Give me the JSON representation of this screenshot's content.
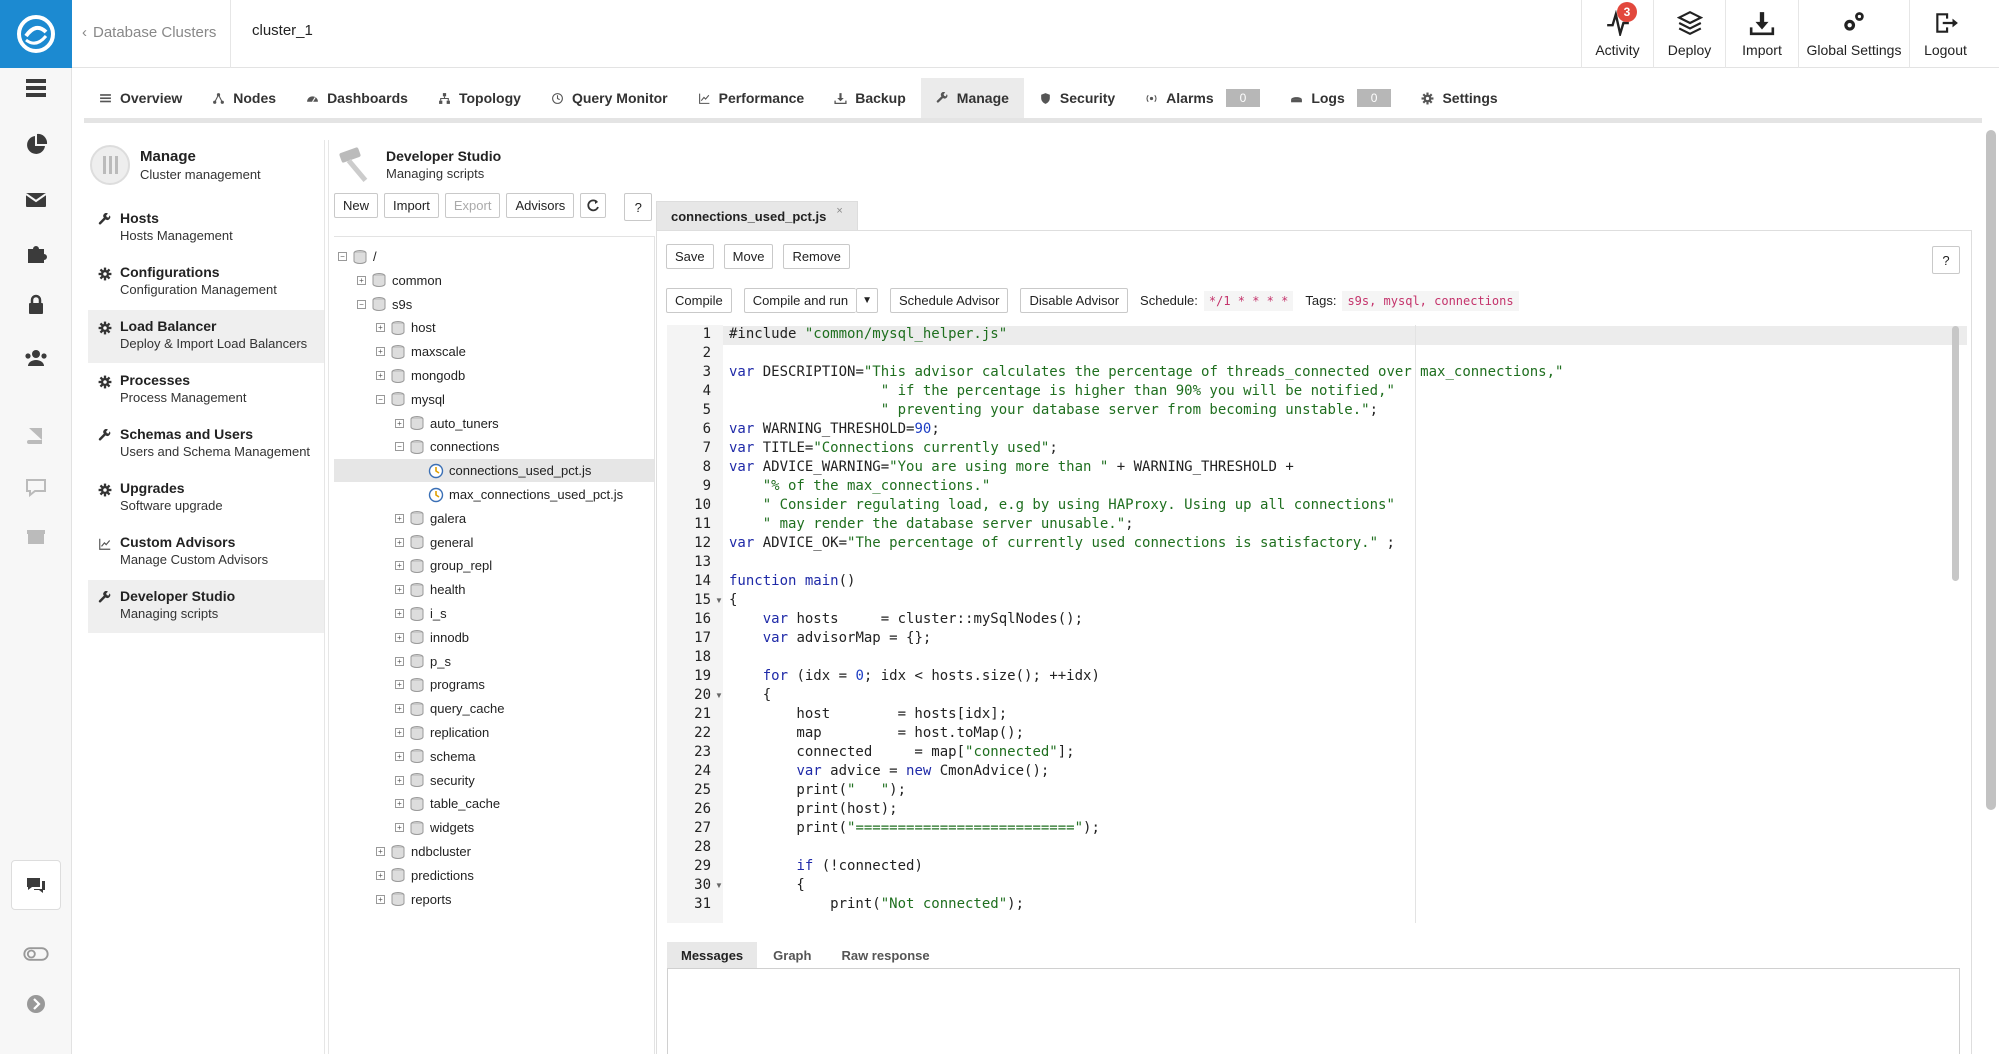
{
  "rail": {
    "icons": [
      "clusters-icon",
      "dashboard-pie-icon",
      "mail-icon",
      "puzzle-icon",
      "lock-icon",
      "users-icon",
      "book-icon",
      "chat-bubble-icon",
      "gift-icon",
      "chat-icon",
      "toggle-icon",
      "chevron-right-circle-icon"
    ]
  },
  "topbar": {
    "back_label": "Database Clusters",
    "cluster": "cluster_1",
    "actions": [
      {
        "label": "Activity",
        "icon": "activity-icon",
        "badge": "3"
      },
      {
        "label": "Deploy",
        "icon": "deploy-layers-icon"
      },
      {
        "label": "Import",
        "icon": "import-icon"
      },
      {
        "label": "Global Settings",
        "icon": "gears-icon"
      },
      {
        "label": "Logout",
        "icon": "logout-icon"
      }
    ]
  },
  "navtabs": [
    {
      "label": "Overview",
      "icon": "list-icon"
    },
    {
      "label": "Nodes",
      "icon": "nodes-icon"
    },
    {
      "label": "Dashboards",
      "icon": "gauge-icon"
    },
    {
      "label": "Topology",
      "icon": "topology-icon"
    },
    {
      "label": "Query Monitor",
      "icon": "query-icon"
    },
    {
      "label": "Performance",
      "icon": "chart-icon"
    },
    {
      "label": "Backup",
      "icon": "download-icon"
    },
    {
      "label": "Manage",
      "icon": "wrench-icon",
      "active": true
    },
    {
      "label": "Security",
      "icon": "shield-icon"
    },
    {
      "label": "Alarms",
      "icon": "alarm-icon",
      "count": "0"
    },
    {
      "label": "Logs",
      "icon": "logs-icon",
      "count": "0"
    },
    {
      "label": "Settings",
      "icon": "gear-icon"
    }
  ],
  "manage": {
    "title": "Manage",
    "subtitle": "Cluster management",
    "items": [
      {
        "title": "Hosts",
        "subtitle": "Hosts Management",
        "icon": "wrench-icon"
      },
      {
        "title": "Configurations",
        "subtitle": "Configuration Management",
        "icon": "gear-icon"
      },
      {
        "title": "Load Balancer",
        "subtitle": "Deploy & Import Load Balancers",
        "icon": "gear-icon",
        "selected": true
      },
      {
        "title": "Processes",
        "subtitle": "Process Management",
        "icon": "gear-icon"
      },
      {
        "title": "Schemas and Users",
        "subtitle": "Users and Schema Management",
        "icon": "wrench-icon"
      },
      {
        "title": "Upgrades",
        "subtitle": "Software upgrade",
        "icon": "gear-icon"
      },
      {
        "title": "Custom Advisors",
        "subtitle": "Manage Custom Advisors",
        "icon": "chart-icon"
      },
      {
        "title": "Developer Studio",
        "subtitle": "Managing scripts",
        "icon": "wrench-icon",
        "selected": true
      }
    ]
  },
  "studio": {
    "title": "Developer Studio",
    "subtitle": "Managing scripts",
    "buttons": {
      "new": "New",
      "import": "Import",
      "export": "Export",
      "advisors": "Advisors",
      "help": "?"
    },
    "tree": [
      {
        "label": "/",
        "depth": 0,
        "type": "folder",
        "toggle": "−"
      },
      {
        "label": "common",
        "depth": 1,
        "type": "folder",
        "toggle": "+"
      },
      {
        "label": "s9s",
        "depth": 1,
        "type": "folder",
        "toggle": "−"
      },
      {
        "label": "host",
        "depth": 2,
        "type": "folder",
        "toggle": "+"
      },
      {
        "label": "maxscale",
        "depth": 2,
        "type": "folder",
        "toggle": "+"
      },
      {
        "label": "mongodb",
        "depth": 2,
        "type": "folder",
        "toggle": "+"
      },
      {
        "label": "mysql",
        "depth": 2,
        "type": "folder",
        "toggle": "−"
      },
      {
        "label": "auto_tuners",
        "depth": 3,
        "type": "folder",
        "toggle": "+"
      },
      {
        "label": "connections",
        "depth": 3,
        "type": "folder",
        "toggle": "−"
      },
      {
        "label": "connections_used_pct.js",
        "depth": 4,
        "type": "file",
        "selected": true
      },
      {
        "label": "max_connections_used_pct.js",
        "depth": 4,
        "type": "file"
      },
      {
        "label": "galera",
        "depth": 3,
        "type": "folder",
        "toggle": "+"
      },
      {
        "label": "general",
        "depth": 3,
        "type": "folder",
        "toggle": "+"
      },
      {
        "label": "group_repl",
        "depth": 3,
        "type": "folder",
        "toggle": "+"
      },
      {
        "label": "health",
        "depth": 3,
        "type": "folder",
        "toggle": "+"
      },
      {
        "label": "i_s",
        "depth": 3,
        "type": "folder",
        "toggle": "+"
      },
      {
        "label": "innodb",
        "depth": 3,
        "type": "folder",
        "toggle": "+"
      },
      {
        "label": "p_s",
        "depth": 3,
        "type": "folder",
        "toggle": "+"
      },
      {
        "label": "programs",
        "depth": 3,
        "type": "folder",
        "toggle": "+"
      },
      {
        "label": "query_cache",
        "depth": 3,
        "type": "folder",
        "toggle": "+"
      },
      {
        "label": "replication",
        "depth": 3,
        "type": "folder",
        "toggle": "+"
      },
      {
        "label": "schema",
        "depth": 3,
        "type": "folder",
        "toggle": "+"
      },
      {
        "label": "security",
        "depth": 3,
        "type": "folder",
        "toggle": "+"
      },
      {
        "label": "table_cache",
        "depth": 3,
        "type": "folder",
        "toggle": "+"
      },
      {
        "label": "widgets",
        "depth": 3,
        "type": "folder",
        "toggle": "+"
      },
      {
        "label": "ndbcluster",
        "depth": 2,
        "type": "folder",
        "toggle": "+"
      },
      {
        "label": "predictions",
        "depth": 2,
        "type": "folder",
        "toggle": "+"
      },
      {
        "label": "reports",
        "depth": 2,
        "type": "folder",
        "toggle": "+"
      }
    ]
  },
  "editor": {
    "file_tab": "connections_used_pct.js",
    "close": "×",
    "save": "Save",
    "move": "Move",
    "remove": "Remove",
    "help": "?",
    "compile": "Compile",
    "compile_and_run": "Compile and run",
    "schedule_advisor": "Schedule Advisor",
    "disable_advisor": "Disable Advisor",
    "schedule_label": "Schedule:",
    "schedule_value": "*/1 * * * *",
    "tags_label": "Tags:",
    "tags_value": "s9s, mysql, connections",
    "lines": [
      {
        "n": "1",
        "segs": [
          [
            "",
            "#include "
          ],
          [
            "st",
            "\"common/mysql_helper.js\""
          ]
        ]
      },
      {
        "n": "2",
        "segs": []
      },
      {
        "n": "3",
        "segs": [
          [
            "kw",
            "var"
          ],
          [
            "",
            " DESCRIPTION="
          ],
          [
            "st",
            "\"This advisor calculates the percentage of threads_connected over max_connections,\""
          ]
        ]
      },
      {
        "n": "4",
        "segs": [
          [
            "st",
            "                  \" if the percentage is higher than 90% you will be notified,\""
          ]
        ]
      },
      {
        "n": "5",
        "segs": [
          [
            "st",
            "                  \" preventing your database server from becoming unstable.\""
          ],
          [
            "",
            ";"
          ]
        ]
      },
      {
        "n": "6",
        "segs": [
          [
            "kw",
            "var"
          ],
          [
            "",
            " WARNING_THRESHOLD="
          ],
          [
            "nm",
            "90"
          ],
          [
            "",
            ";"
          ]
        ]
      },
      {
        "n": "7",
        "segs": [
          [
            "kw",
            "var"
          ],
          [
            "",
            " TITLE="
          ],
          [
            "st",
            "\"Connections currently used\""
          ],
          [
            "",
            ";"
          ]
        ]
      },
      {
        "n": "8",
        "segs": [
          [
            "kw",
            "var"
          ],
          [
            "",
            " ADVICE_WARNING="
          ],
          [
            "st",
            "\"You are using more than \""
          ],
          [
            "",
            " + WARNING_THRESHOLD +"
          ]
        ]
      },
      {
        "n": "9",
        "segs": [
          [
            "st",
            "    \"% of the max_connections.\""
          ]
        ]
      },
      {
        "n": "10",
        "segs": [
          [
            "st",
            "    \" Consider regulating load, e.g by using HAProxy. Using up all connections\""
          ]
        ]
      },
      {
        "n": "11",
        "segs": [
          [
            "st",
            "    \" may render the database server unusable.\""
          ],
          [
            "",
            ";"
          ]
        ]
      },
      {
        "n": "12",
        "segs": [
          [
            "kw",
            "var"
          ],
          [
            "",
            " ADVICE_OK="
          ],
          [
            "st",
            "\"The percentage of currently used connections is satisfactory.\""
          ],
          [
            "",
            " ;"
          ]
        ]
      },
      {
        "n": "13",
        "segs": []
      },
      {
        "n": "14",
        "segs": [
          [
            "kw",
            "function"
          ],
          [
            "",
            " "
          ],
          [
            "kw",
            "main"
          ],
          [
            "",
            "()"
          ]
        ]
      },
      {
        "n": "15",
        "fold": true,
        "segs": [
          [
            "",
            "{"
          ]
        ]
      },
      {
        "n": "16",
        "segs": [
          [
            "",
            "    "
          ],
          [
            "kw",
            "var"
          ],
          [
            "",
            " hosts     = cluster::mySqlNodes();"
          ]
        ]
      },
      {
        "n": "17",
        "segs": [
          [
            "",
            "    "
          ],
          [
            "kw",
            "var"
          ],
          [
            "",
            " advisorMap = {};"
          ]
        ]
      },
      {
        "n": "18",
        "segs": []
      },
      {
        "n": "19",
        "segs": [
          [
            "",
            "    "
          ],
          [
            "kw",
            "for"
          ],
          [
            "",
            " (idx = "
          ],
          [
            "nm",
            "0"
          ],
          [
            "",
            "; idx < hosts.size(); ++idx)"
          ]
        ]
      },
      {
        "n": "20",
        "fold": true,
        "segs": [
          [
            "",
            "    {"
          ]
        ]
      },
      {
        "n": "21",
        "segs": [
          [
            "",
            "        host        = hosts[idx];"
          ]
        ]
      },
      {
        "n": "22",
        "segs": [
          [
            "",
            "        map         = host.toMap();"
          ]
        ]
      },
      {
        "n": "23",
        "segs": [
          [
            "",
            "        connected     = map["
          ],
          [
            "st",
            "\"connected\""
          ],
          [
            "",
            "];"
          ]
        ]
      },
      {
        "n": "24",
        "segs": [
          [
            "",
            "        "
          ],
          [
            "kw",
            "var"
          ],
          [
            "",
            " advice = "
          ],
          [
            "kw",
            "new"
          ],
          [
            "",
            " CmonAdvice();"
          ]
        ]
      },
      {
        "n": "25",
        "segs": [
          [
            "",
            "        print("
          ],
          [
            "st",
            "\"   \""
          ],
          [
            "",
            ");"
          ]
        ]
      },
      {
        "n": "26",
        "segs": [
          [
            "",
            "        print(host);"
          ]
        ]
      },
      {
        "n": "27",
        "segs": [
          [
            "",
            "        print("
          ],
          [
            "st",
            "\"==========================\""
          ],
          [
            "",
            ");"
          ]
        ]
      },
      {
        "n": "28",
        "segs": []
      },
      {
        "n": "29",
        "segs": [
          [
            "",
            "        "
          ],
          [
            "kw",
            "if"
          ],
          [
            "",
            " (!connected)"
          ]
        ]
      },
      {
        "n": "30",
        "fold": true,
        "segs": [
          [
            "",
            "        {"
          ]
        ]
      },
      {
        "n": "31",
        "segs": [
          [
            "",
            "            print("
          ],
          [
            "st",
            "\"Not connected\""
          ],
          [
            "",
            ");"
          ]
        ]
      }
    ]
  },
  "output_tabs": [
    "Messages",
    "Graph",
    "Raw response"
  ]
}
